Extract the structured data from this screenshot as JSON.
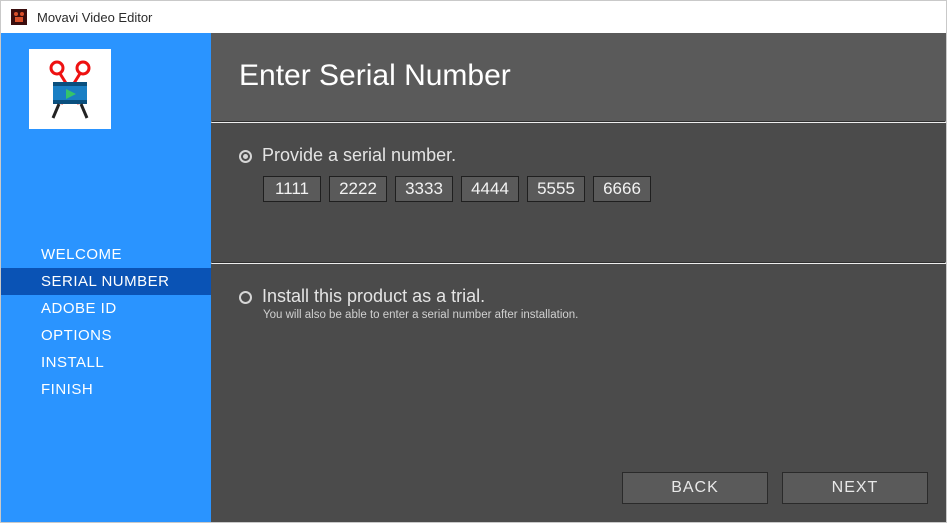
{
  "app": {
    "title": "Movavi Video Editor"
  },
  "sidebar": {
    "items": [
      {
        "label": "WELCOME"
      },
      {
        "label": "SERIAL NUMBER"
      },
      {
        "label": "ADOBE ID"
      },
      {
        "label": "OPTIONS"
      },
      {
        "label": "INSTALL"
      },
      {
        "label": "FINISH"
      }
    ],
    "active_index": 1
  },
  "page": {
    "title": "Enter Serial Number",
    "option_serial": {
      "label": "Provide a serial number.",
      "selected": true,
      "values": [
        "1111",
        "2222",
        "3333",
        "4444",
        "5555",
        "6666"
      ]
    },
    "option_trial": {
      "label": "Install this product as a trial.",
      "note": "You will also be able to enter a serial number after installation.",
      "selected": false
    }
  },
  "footer": {
    "back": "BACK",
    "next": "NEXT"
  }
}
